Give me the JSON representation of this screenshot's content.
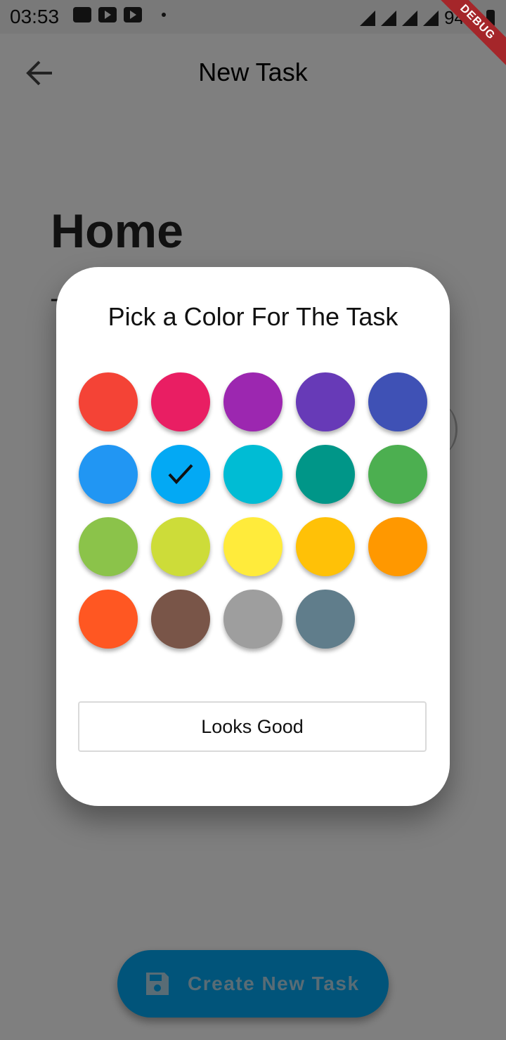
{
  "status_bar": {
    "time": "03:53",
    "battery": "94%"
  },
  "debug_banner": "DEBUG",
  "app_bar": {
    "back_icon": "arrow-back-icon",
    "title": "New Task"
  },
  "background": {
    "heading": "Home",
    "subline_char": "T"
  },
  "fab": {
    "icon": "save-icon",
    "label": "Create New Task",
    "color": "#03a9f4"
  },
  "dialog": {
    "title": "Pick a Color For The Task",
    "selected_index": 6,
    "colors": [
      "#f44336",
      "#e91e63",
      "#9c27b0",
      "#673ab7",
      "#3f51b5",
      "#2196f3",
      "#03a9f4",
      "#00bcd4",
      "#009688",
      "#4caf50",
      "#8bc34a",
      "#cddc39",
      "#ffeb3b",
      "#ffc107",
      "#ff9800",
      "#ff5722",
      "#795548",
      "#9e9e9e",
      "#607d8b"
    ],
    "confirm_label": "Looks Good"
  }
}
